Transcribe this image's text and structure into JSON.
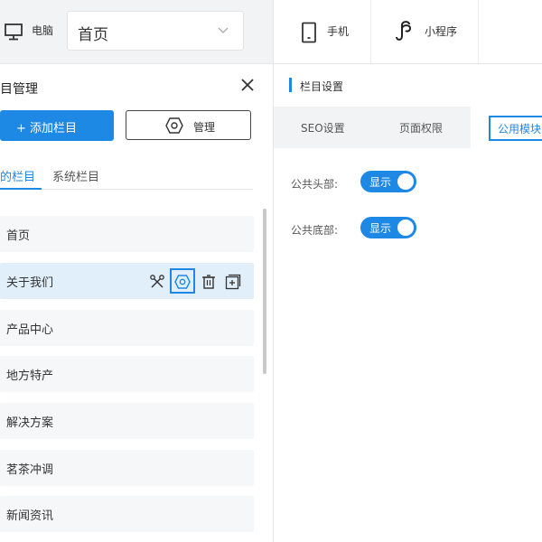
{
  "topbar": {
    "device_pc": "电脑",
    "page_select": "首页",
    "device_mobile": "手机",
    "device_miniapp": "小程序"
  },
  "left_panel": {
    "title": "目管理",
    "add_button": "+ 添加栏目",
    "manage_button": "管理",
    "tabs": [
      "的栏目",
      "系统栏目"
    ],
    "items": [
      {
        "label": "首页"
      },
      {
        "label": "关于我们"
      },
      {
        "label": "产品中心"
      },
      {
        "label": "地方特产"
      },
      {
        "label": "解决方案"
      },
      {
        "label": "茗茶冲调"
      },
      {
        "label": "新闻资讯"
      }
    ]
  },
  "right_panel": {
    "section_title": "栏目设置",
    "tabs": [
      "SEO设置",
      "页面权限",
      "公用模块"
    ],
    "options": [
      {
        "label": "公共头部:",
        "toggle": "显示"
      },
      {
        "label": "公共底部:",
        "toggle": "显示"
      }
    ]
  },
  "colors": {
    "accent": "#1e88e5",
    "panel_bg": "#f2f3f5",
    "item_bg": "#f6f7f9",
    "active_item_bg": "#e1effb"
  }
}
